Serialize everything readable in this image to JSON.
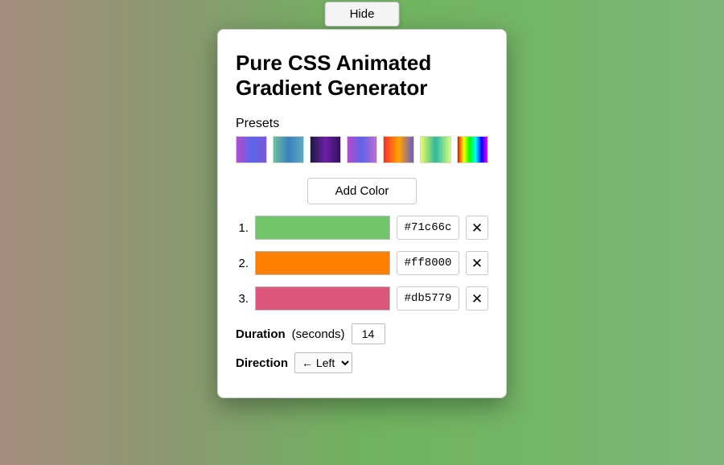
{
  "hide_button": "Hide",
  "title": "Pure CSS Animated Gradient Generator",
  "presets_label": "Presets",
  "add_color_label": "Add Color",
  "colors": [
    {
      "n": "1.",
      "hex": "#71c66c"
    },
    {
      "n": "2.",
      "hex": "#ff8000"
    },
    {
      "n": "3.",
      "hex": "#db5779"
    }
  ],
  "duration": {
    "label": "Duration",
    "unit": "(seconds)",
    "value": "14"
  },
  "direction": {
    "label": "Direction",
    "value": "← Left"
  }
}
